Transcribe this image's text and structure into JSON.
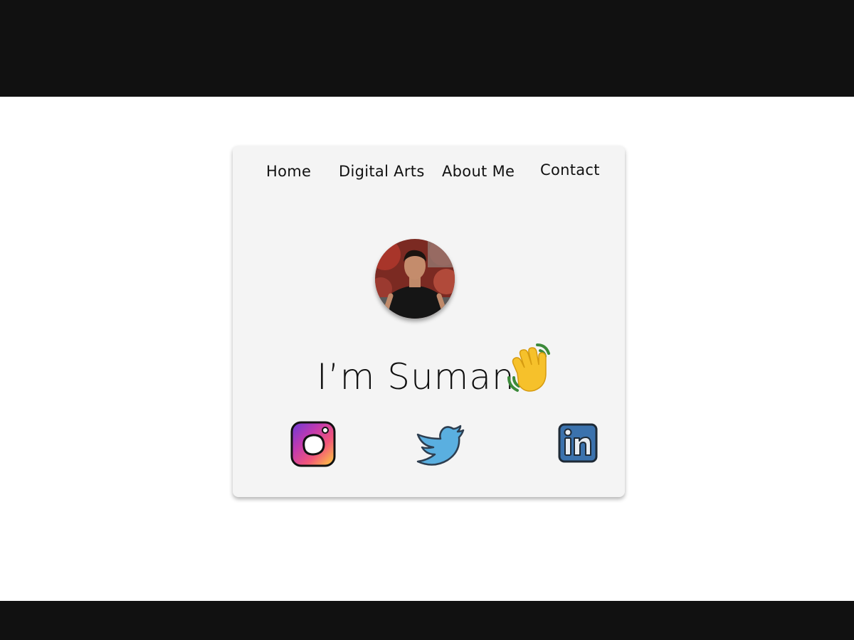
{
  "nav": {
    "items": [
      {
        "label": "Home"
      },
      {
        "label": "Digital Arts"
      },
      {
        "label": "About Me"
      },
      {
        "label": "Contact"
      }
    ]
  },
  "profile": {
    "greeting": "I’m Suman"
  },
  "social": {
    "icons": [
      "instagram-icon",
      "twitter-icon",
      "linkedin-icon"
    ]
  },
  "colors": {
    "page_bar": "#111111",
    "background": "#ffffff",
    "card": "#f4f4f4",
    "text": "#111111",
    "twitter": "#5aafe0",
    "linkedin": "#3b72ad"
  }
}
